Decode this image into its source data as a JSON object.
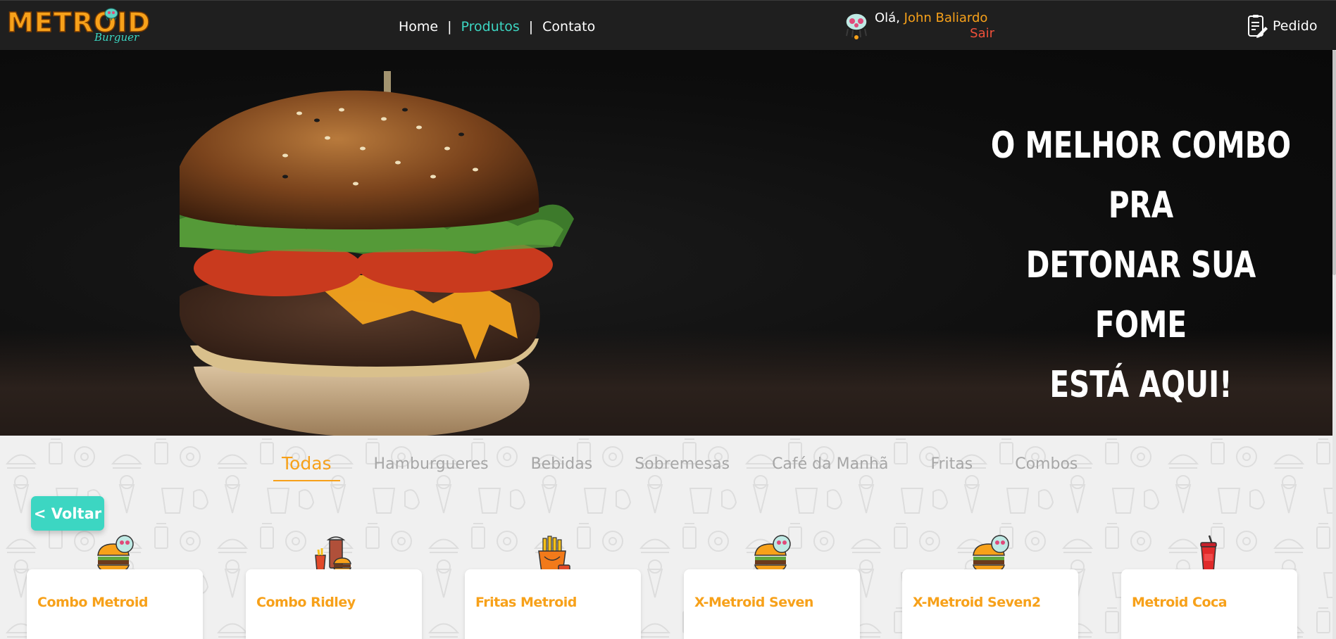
{
  "brand": {
    "logo_text": "METROID",
    "logo_subtext": "Burguer",
    "colors": {
      "orange": "#f7a11a",
      "teal": "#3cd6c2",
      "red": "#f0503a",
      "nav_bg": "#1f1f1f"
    }
  },
  "nav": {
    "links": [
      {
        "label": "Home",
        "active": false
      },
      {
        "label": "Produtos",
        "active": true
      },
      {
        "label": "Contato",
        "active": false
      }
    ],
    "separator": "|"
  },
  "user": {
    "greeting": "Olá,",
    "name": "John Baliardo",
    "logout": "Sair",
    "avatar_icon": "metroid-mascot-icon"
  },
  "order": {
    "label": "Pedido",
    "icon": "clipboard-edit-icon"
  },
  "hero": {
    "lines": [
      "O MELHOR COMBO PRA",
      "DETONAR SUA FOME",
      "ESTÁ AQUI!"
    ]
  },
  "categories": [
    {
      "label": "Todas",
      "active": true
    },
    {
      "label": "Hamburgueres",
      "active": false
    },
    {
      "label": "Bebidas",
      "active": false
    },
    {
      "label": "Sobremesas",
      "active": false
    },
    {
      "label": "Café da Manhã",
      "active": false
    },
    {
      "label": "Fritas",
      "active": false
    },
    {
      "label": "Combos",
      "active": false
    }
  ],
  "back_button": "< Voltar",
  "products": [
    {
      "name": "Combo Metroid",
      "icon": "burger-mascot-icon"
    },
    {
      "name": "Combo Ridley",
      "icon": "combo-meal-icon"
    },
    {
      "name": "Fritas Metroid",
      "icon": "fries-icon"
    },
    {
      "name": "X-Metroid Seven",
      "icon": "burger-mascot-icon"
    },
    {
      "name": "X-Metroid Seven2",
      "icon": "burger-mascot-icon"
    },
    {
      "name": "Metroid Coca",
      "icon": "soda-cup-icon"
    }
  ]
}
